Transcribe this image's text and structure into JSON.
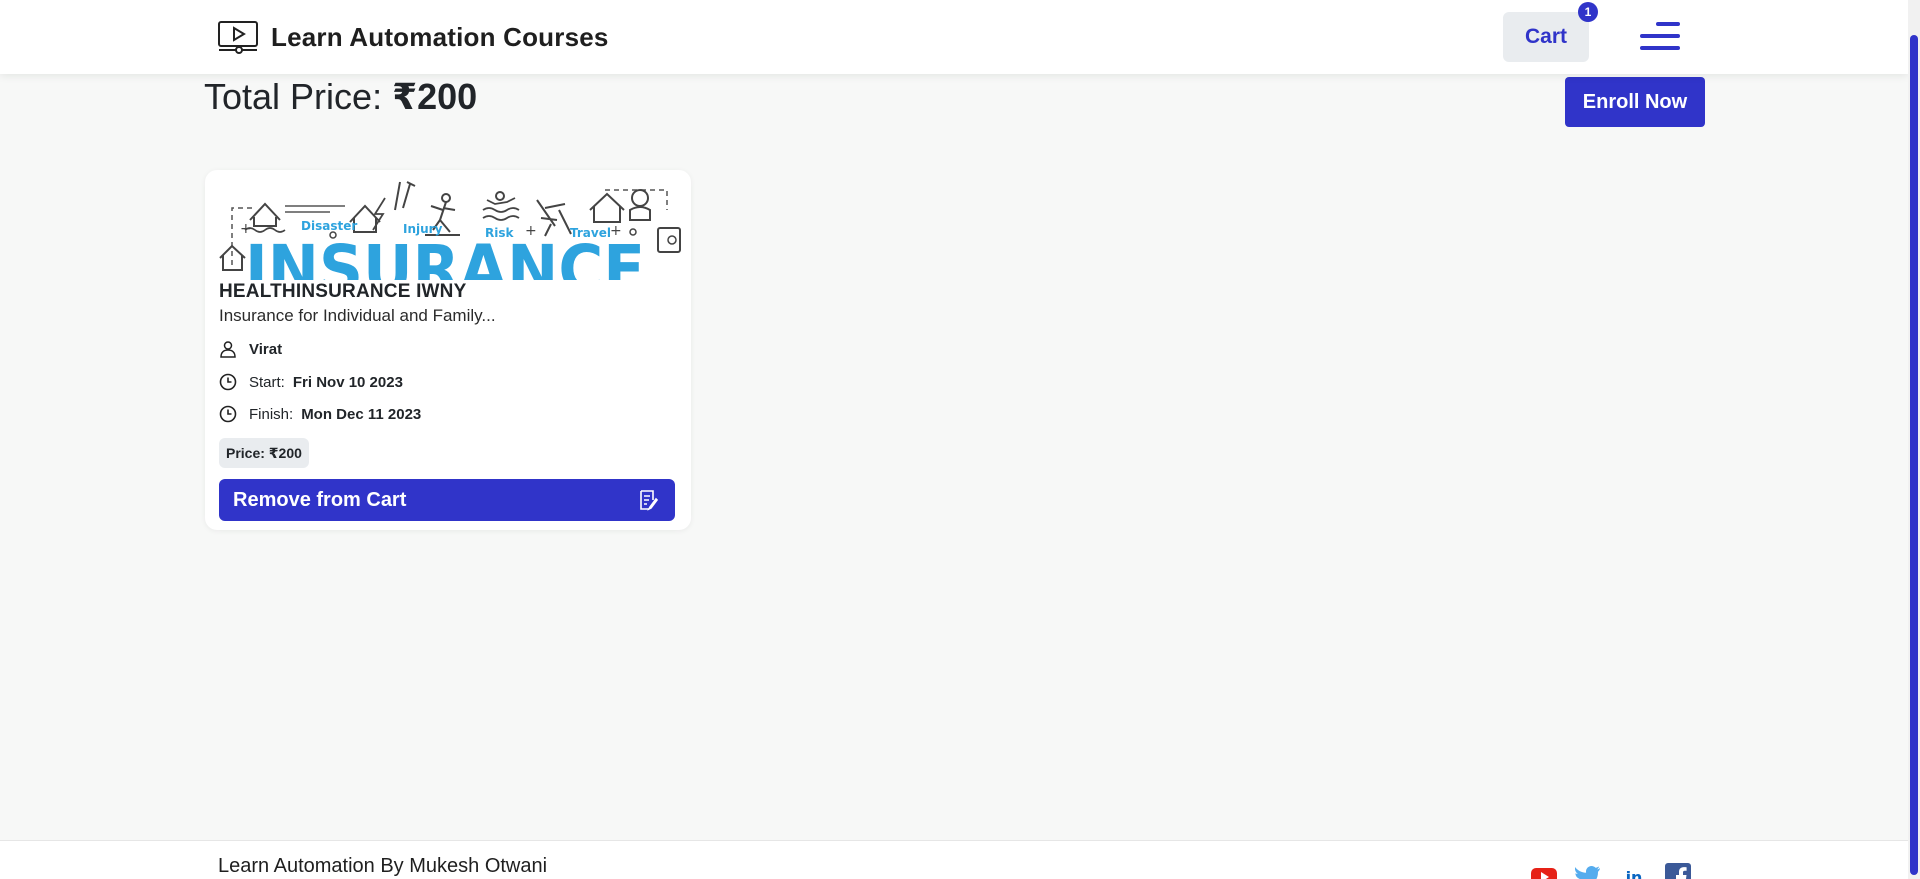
{
  "header": {
    "brand": "Learn Automation Courses",
    "cart_label": "Cart",
    "cart_count": "1"
  },
  "summary": {
    "total_label": "Total Price: ",
    "total_value": "₹200",
    "enroll_label": "Enroll Now"
  },
  "course": {
    "image_words": {
      "big": "INSURANCE",
      "disaster": "Disaster",
      "injury": "Injury",
      "risk": "Risk",
      "travel": "Travel"
    },
    "title": "HEALTHINSURANCE IWNY",
    "description": "Insurance for Individual and Family...",
    "author": "Virat",
    "start_label": "Start:",
    "start_date": "Fri Nov 10 2023",
    "finish_label": "Finish:",
    "finish_date": "Mon Dec 11 2023",
    "price": "Price: ₹200",
    "remove_label": "Remove from Cart"
  },
  "footer": {
    "text": "Learn Automation By Mukesh Otwani",
    "social": [
      "youtube-icon",
      "twitter-icon",
      "linkedin-icon",
      "facebook-icon"
    ]
  },
  "colors": {
    "accent": "#3034c9",
    "insurance_blue": "#2ea3de",
    "background": "#f7f8f7"
  }
}
